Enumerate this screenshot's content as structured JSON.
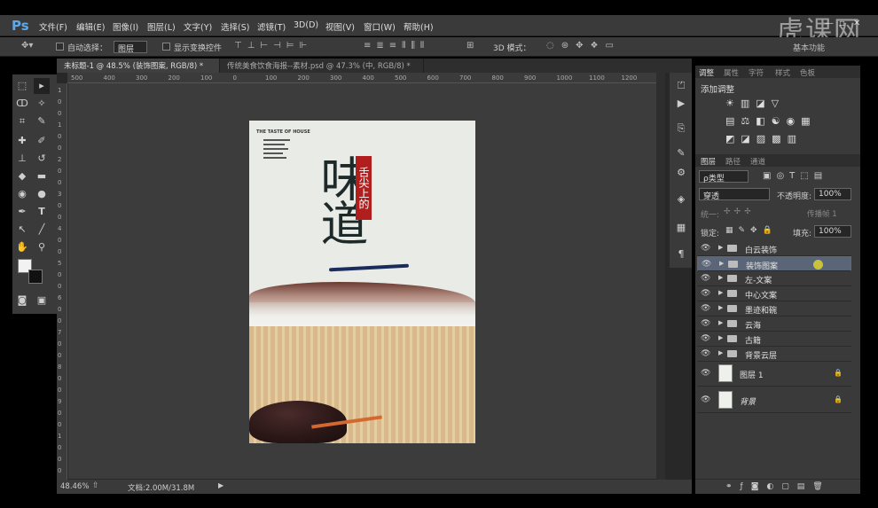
{
  "menus": [
    "文件(F)",
    "编辑(E)",
    "图像(I)",
    "图层(L)",
    "文字(Y)",
    "选择(S)",
    "滤镜(T)",
    "3D(D)",
    "视图(V)",
    "窗口(W)",
    "帮助(H)"
  ],
  "logo": "Ps",
  "options": {
    "auto_select": "自动选择：",
    "auto_select_value": "图层",
    "show_transform": "显示变换控件",
    "mode3d": "3D 模式：",
    "workspace": "基本功能"
  },
  "tabs": [
    "未标题-1 @ 48.5% (装饰图案, RGB/8) *",
    "传统美食饮食海报--素材.psd @ 47.3% (中, RGB/8) *"
  ],
  "ruler_h": [
    "500",
    "400",
    "300",
    "200",
    "100",
    "0",
    "100",
    "200",
    "300",
    "400",
    "500",
    "600",
    "700",
    "800",
    "900",
    "1000",
    "1100",
    "1200"
  ],
  "ruler_v": [
    "1",
    "0",
    "0",
    "1",
    "0",
    "0",
    "2",
    "0",
    "0",
    "3",
    "0",
    "0",
    "4",
    "0",
    "0",
    "5",
    "0",
    "0",
    "6",
    "0",
    "0",
    "7",
    "0",
    "0",
    "8",
    "0",
    "0",
    "9",
    "0",
    "0",
    "1",
    "0",
    "0",
    "0"
  ],
  "status": {
    "zoom": "48.46%",
    "doc": "文档:2.00M/31.8M"
  },
  "adj_tabs": [
    "调整",
    "属性",
    "字符",
    "样式",
    "色板"
  ],
  "adj_title": "添加调整",
  "layer_tabs": [
    "图层",
    "路径",
    "通道"
  ],
  "layer_filter": "ρ类型",
  "blend_mode": "穿透",
  "opacity_label": "不透明度:",
  "opacity": "100%",
  "unify_label": "统一:",
  "propagate": "传播帧 1",
  "lock_label": "锁定:",
  "fill_label": "填充:",
  "fill": "100%",
  "layers": [
    {
      "name": "白云装饰",
      "type": "group"
    },
    {
      "name": "装饰图案",
      "type": "group",
      "selected": true
    },
    {
      "name": "左-文案",
      "type": "group"
    },
    {
      "name": "中心文案",
      "type": "group"
    },
    {
      "name": "墨迹和碗",
      "type": "group"
    },
    {
      "name": "云海",
      "type": "group"
    },
    {
      "name": "古籍",
      "type": "group"
    },
    {
      "name": "背景云层",
      "type": "group"
    },
    {
      "name": "图层 1",
      "type": "pixel",
      "locked": true
    },
    {
      "name": "背景",
      "type": "pixel",
      "locked": true
    }
  ],
  "poster": {
    "title": "味道",
    "seal": "舌尖上的",
    "small_head": "THE TASTE OF HOUSE"
  },
  "watermark": "虎课网"
}
